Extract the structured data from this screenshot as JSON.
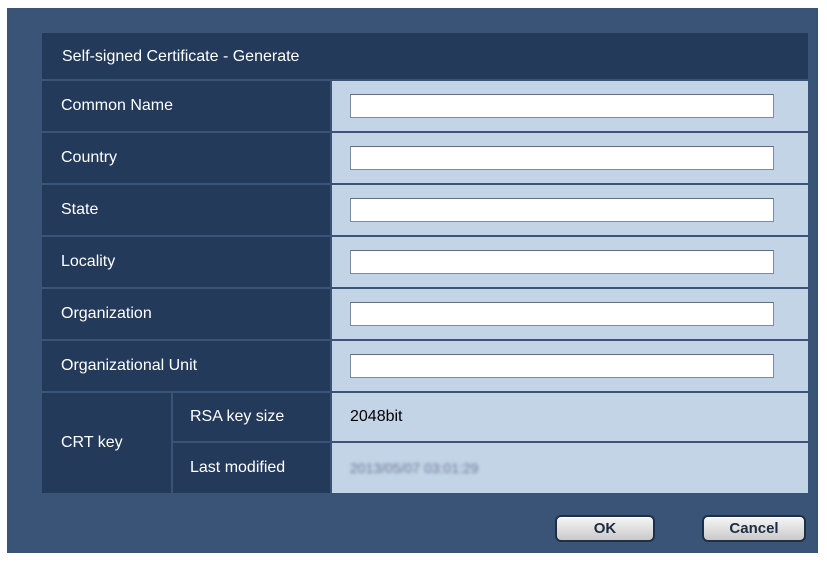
{
  "dialog": {
    "title": "Self-signed Certificate - Generate",
    "fields": [
      {
        "label": "Common Name",
        "value": ""
      },
      {
        "label": "Country",
        "value": ""
      },
      {
        "label": "State",
        "value": ""
      },
      {
        "label": "Locality",
        "value": ""
      },
      {
        "label": "Organization",
        "value": ""
      },
      {
        "label": "Organizational Unit",
        "value": ""
      }
    ],
    "crt_key": {
      "label": "CRT key",
      "rsa_label": "RSA key size",
      "rsa_value": "2048bit",
      "modified_label": "Last modified",
      "modified_value": "2013/05/07 03:01:29"
    }
  },
  "buttons": {
    "ok": "OK",
    "cancel": "Cancel"
  },
  "colors": {
    "dialog_bg": "#3a5478",
    "label_bg": "#233a5a",
    "value_bg": "#c4d4e7"
  }
}
